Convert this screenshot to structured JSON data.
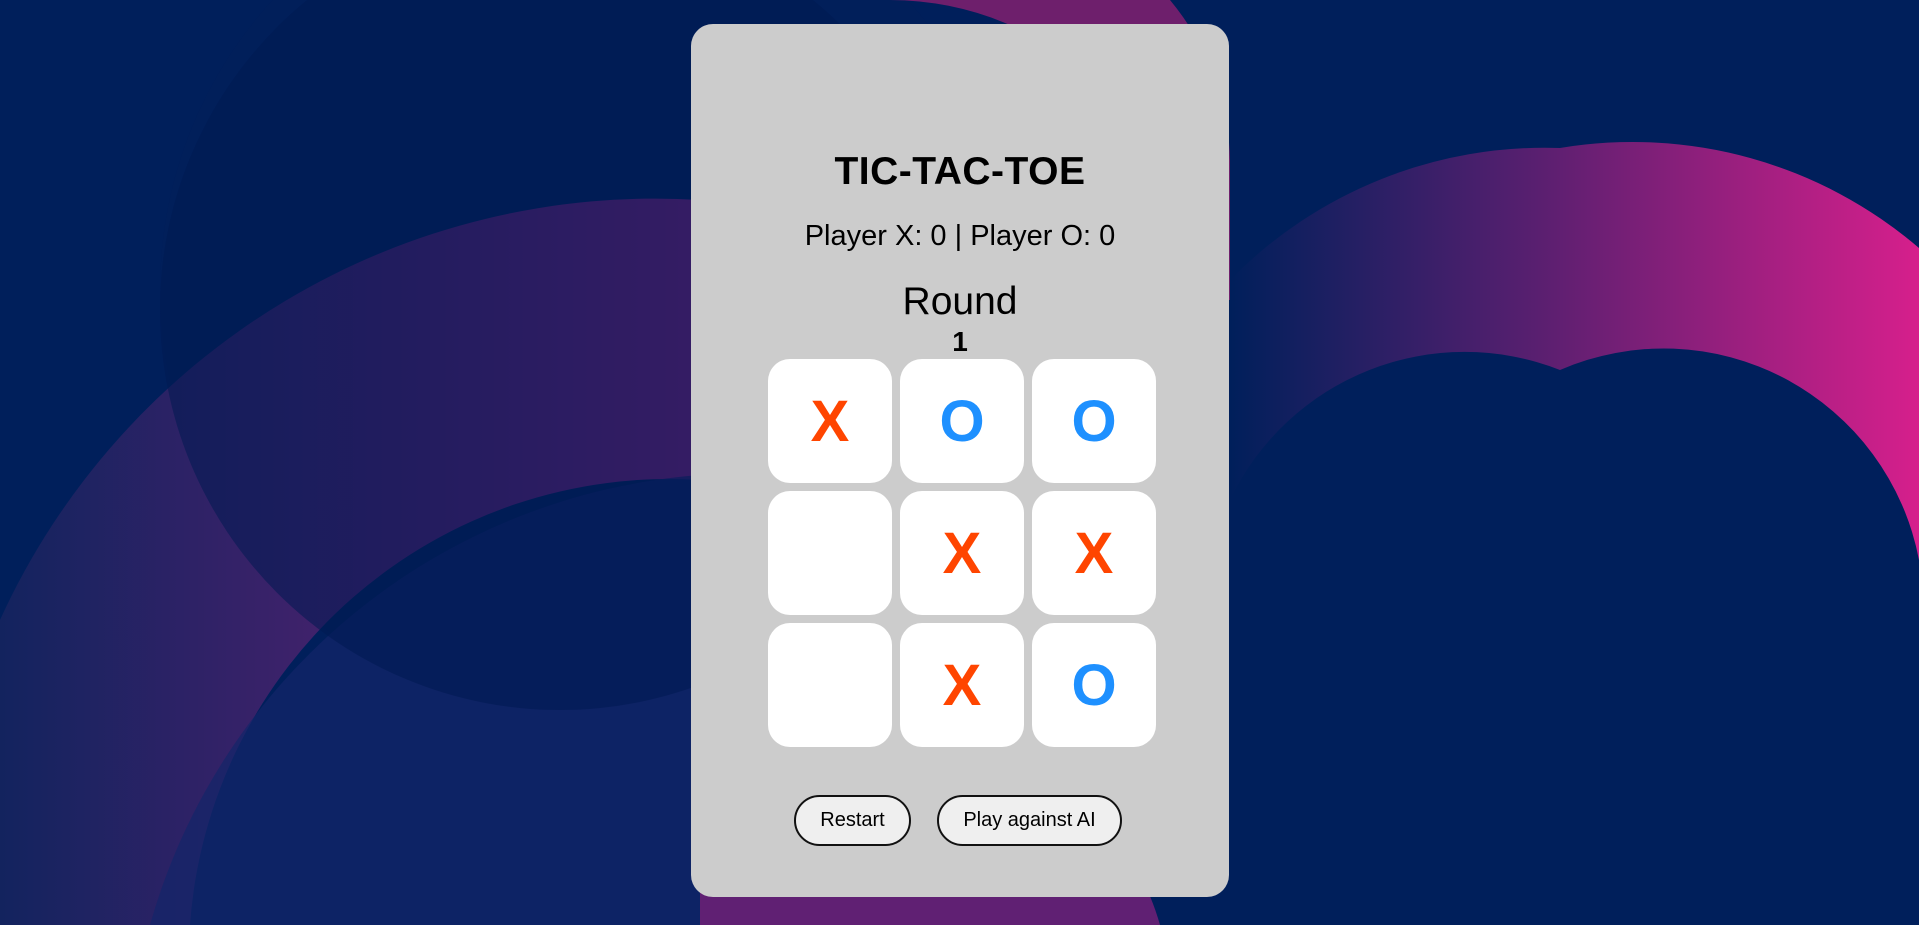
{
  "colors": {
    "background": "#001f5b",
    "accent_magenta": "#d2208f",
    "panel": "#cccccc",
    "x_mark": "#ff4500",
    "o_mark": "#1e90ff"
  },
  "game": {
    "title": "TIC-TAC-TOE",
    "score_text": "Player X: 0 | Player O: 0",
    "round_label": "Round",
    "round_number": "1"
  },
  "board": [
    [
      "X",
      "O",
      "O"
    ],
    [
      "",
      "X",
      "X"
    ],
    [
      "",
      "X",
      "O"
    ]
  ],
  "controls": {
    "restart_label": "Restart",
    "ai_label": "Play against AI"
  }
}
